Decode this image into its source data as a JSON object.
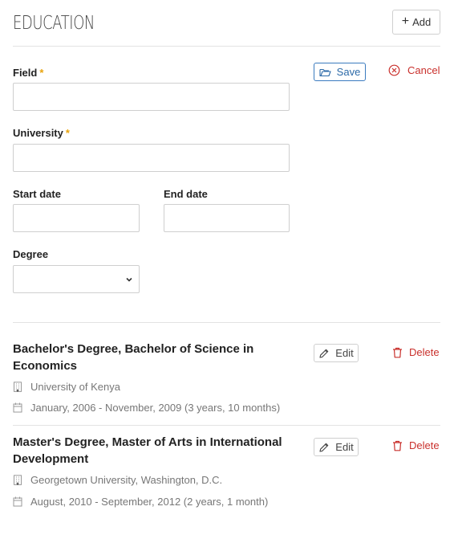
{
  "section": {
    "title": "EDUCATION",
    "add_label": "Add"
  },
  "form": {
    "field_label": "Field",
    "field_value": "",
    "university_label": "University",
    "university_value": "",
    "required_marker": "*",
    "start_date_label": "Start date",
    "start_date_value": "",
    "end_date_label": "End date",
    "end_date_value": "",
    "degree_label": "Degree",
    "degree_selected": "",
    "save_label": "Save",
    "cancel_label": "Cancel"
  },
  "entries": [
    {
      "title": "Bachelor's Degree, Bachelor of Science in Economics",
      "university": "University of Kenya",
      "dates": "January, 2006 - November, 2009 (3 years, 10 months)",
      "edit_label": "Edit",
      "delete_label": "Delete"
    },
    {
      "title": "Master's Degree, Master of Arts in International Development",
      "university": "Georgetown University, Washington, D.C.",
      "dates": "August, 2010 - September, 2012 (2 years, 1 month)",
      "edit_label": "Edit",
      "delete_label": "Delete"
    }
  ],
  "colors": {
    "accent_blue": "#2c6aa8",
    "danger_red": "#c9302c",
    "required_orange": "#e8a30c",
    "border_gray": "#cfcfcf"
  },
  "icons": [
    "plus-icon",
    "folder-open-icon",
    "circle-x-icon",
    "chevron-down-icon",
    "pencil-icon",
    "trash-icon",
    "building-icon",
    "calendar-icon"
  ]
}
